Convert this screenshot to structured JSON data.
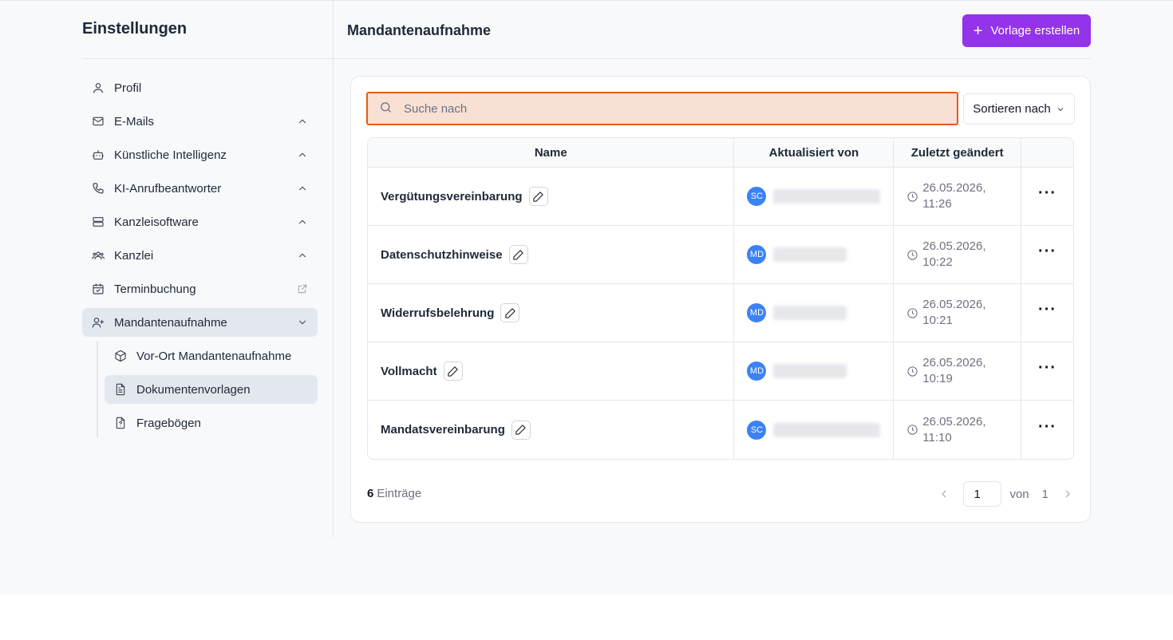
{
  "sidebar": {
    "title": "Einstellungen",
    "items": [
      {
        "label": "Profil",
        "icon": "user-icon"
      },
      {
        "label": "E-Mails",
        "icon": "mail-icon"
      },
      {
        "label": "Künstliche Intelligenz",
        "icon": "robot-icon"
      },
      {
        "label": "KI-Anrufbeantworter",
        "icon": "phone-icon"
      },
      {
        "label": "Kanzleisoftware",
        "icon": "server-icon"
      },
      {
        "label": "Kanzlei",
        "icon": "users-icon"
      },
      {
        "label": "Terminbuchung",
        "icon": "calendar-check-icon"
      },
      {
        "label": "Mandantenaufnahme",
        "icon": "user-plus-icon"
      }
    ],
    "subitems": [
      {
        "label": "Vor-Ort Mandantenaufnahme",
        "icon": "package-icon"
      },
      {
        "label": "Dokumentenvorlagen",
        "icon": "file-text-icon"
      },
      {
        "label": "Fragebögen",
        "icon": "file-question-icon"
      }
    ]
  },
  "header": {
    "title": "Mandantenaufnahme",
    "create_label": "Vorlage erstellen"
  },
  "search": {
    "placeholder": "Suche nach",
    "value": ""
  },
  "sort": {
    "label": "Sortieren nach"
  },
  "table": {
    "columns": [
      "Name",
      "Aktualisiert von",
      "Zuletzt geändert"
    ],
    "rows": [
      {
        "name": "Vergütungsvereinbarung",
        "initials": "SC",
        "date": "26.05.2026,",
        "time": "11:26"
      },
      {
        "name": "Datenschutzhinweise",
        "initials": "MD",
        "date": "26.05.2026,",
        "time": "10:22"
      },
      {
        "name": "Widerrufsbelehrung",
        "initials": "MD",
        "date": "26.05.2026,",
        "time": "10:21"
      },
      {
        "name": "Vollmacht",
        "initials": "MD",
        "date": "26.05.2026,",
        "time": "10:19"
      },
      {
        "name": "Mandatsvereinbarung",
        "initials": "SC",
        "date": "26.05.2026,",
        "time": "11:10"
      }
    ]
  },
  "footer": {
    "count": "6",
    "count_label": "Einträge",
    "page": "1",
    "of_label": "von",
    "total_pages": "1"
  },
  "colors": {
    "accent": "#9333ea",
    "avatar": "#3b82f6",
    "search_border": "#e8591a",
    "search_bg": "#f8e0d5"
  }
}
